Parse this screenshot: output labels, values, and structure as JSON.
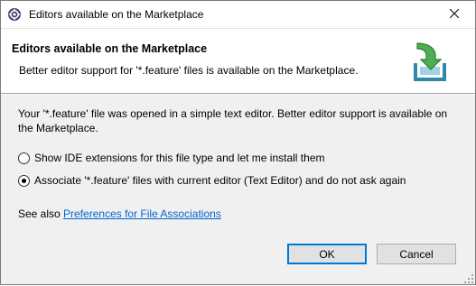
{
  "window": {
    "title": "Editors available on the Marketplace",
    "icon": "eclipse-gear-icon",
    "close_icon": "close-icon"
  },
  "header": {
    "title": "Editors available on the Marketplace",
    "message": "Better editor support for '*.feature' files is available on the Marketplace.",
    "graphic": "marketplace-install-icon"
  },
  "body": {
    "description": "Your '*.feature' file was opened in a simple text editor. Better editor support is available on the Marketplace."
  },
  "options": [
    {
      "label": "Show IDE extensions for this file type and let me install them",
      "selected": false
    },
    {
      "label": "Associate '*.feature' files with current editor (Text Editor) and do not ask again",
      "selected": true
    }
  ],
  "see_also": {
    "prefix": "See also",
    "link": "Preferences for File Associations"
  },
  "buttons": {
    "ok": "OK",
    "cancel": "Cancel"
  },
  "colors": {
    "accent": "#0078d7",
    "link": "#0066cc",
    "icon_green": "#3a9a3a",
    "icon_teal": "#2e8aa8"
  }
}
